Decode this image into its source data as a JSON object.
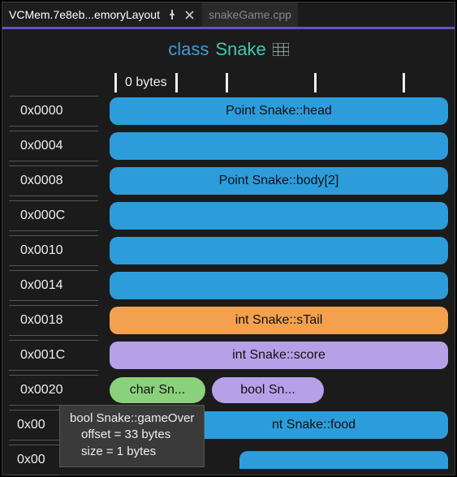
{
  "tabs": {
    "active_label": "VCMem.7e8eb...emoryLayout",
    "inactive_label": "snakeGame.cpp"
  },
  "title": {
    "keyword": "class",
    "name": "Snake"
  },
  "ruler_label": "0 bytes",
  "rows": [
    {
      "addr": "0x0000",
      "label": "Point Snake::head",
      "color": "blue"
    },
    {
      "addr": "0x0004",
      "label": "",
      "color": "blue"
    },
    {
      "addr": "0x0008",
      "label": "Point Snake::body[2]",
      "color": "blue"
    },
    {
      "addr": "0x000C",
      "label": "",
      "color": "blue"
    },
    {
      "addr": "0x0010",
      "label": "",
      "color": "blue"
    },
    {
      "addr": "0x0014",
      "label": "",
      "color": "blue"
    },
    {
      "addr": "0x0018",
      "label": "int Snake::sTail",
      "color": "orange"
    },
    {
      "addr": "0x001C",
      "label": "int Snake::score",
      "color": "purple"
    }
  ],
  "row_pills": {
    "addr": "0x0020",
    "pill1": "char Sn...",
    "pill2": "bool Sn..."
  },
  "row_partial1": {
    "addr_trunc": "0x00",
    "visible_frag": "nt Snake::food",
    "color": "blue"
  },
  "row_partial2": {
    "addr_trunc": "0x00",
    "color": "blue"
  },
  "tooltip": {
    "line1": "bool Snake::gameOver",
    "line2": "offset = 33 bytes",
    "line3": "size = 1 bytes"
  }
}
